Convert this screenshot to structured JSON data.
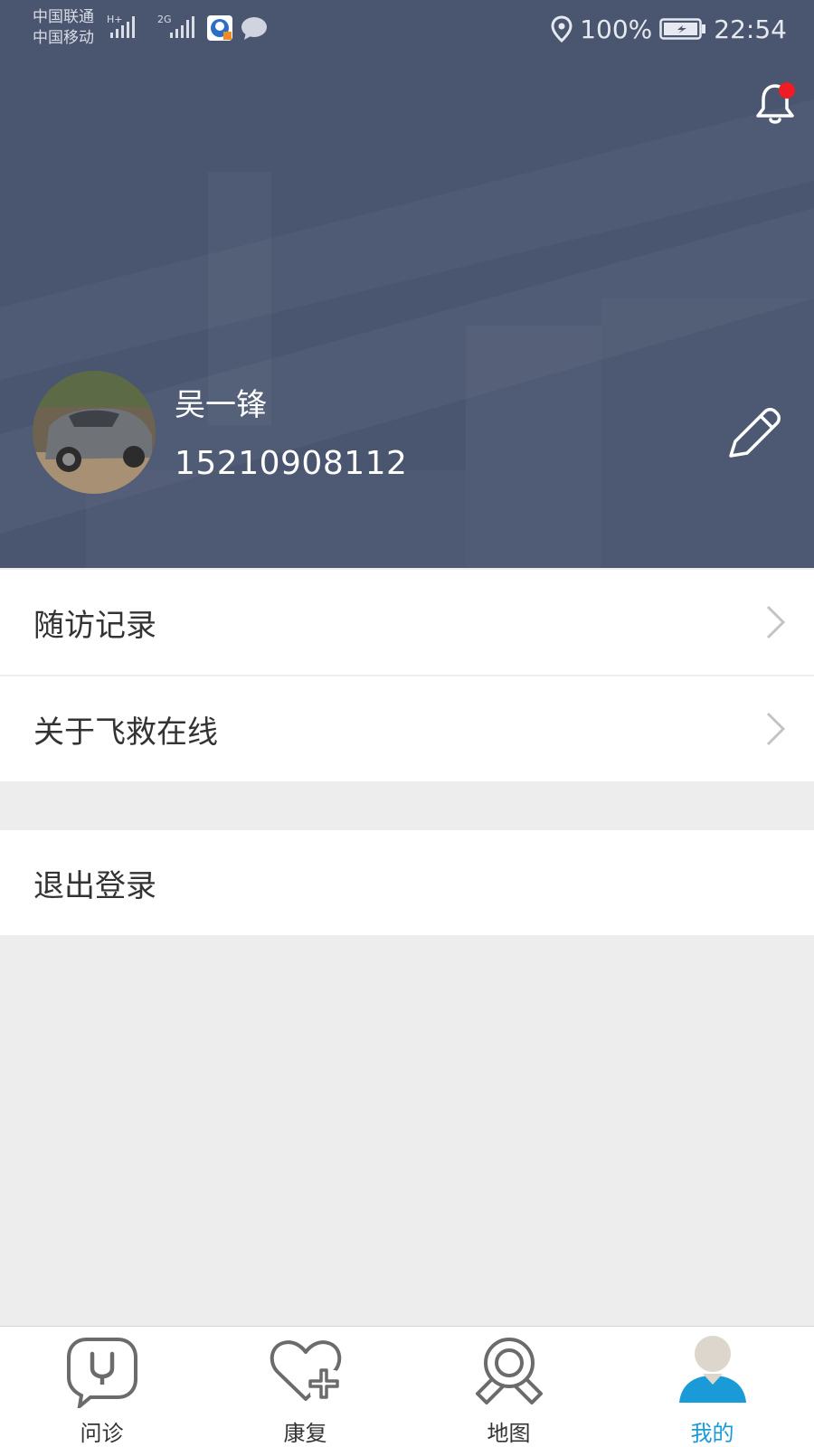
{
  "status_bar": {
    "carrier_1": "中国联通",
    "carrier_2": "中国移动",
    "network_1": "H+",
    "network_2": "2G",
    "battery": "100%",
    "time": "22:54"
  },
  "header": {
    "bg_color": "#4a5670",
    "has_notification": true
  },
  "profile": {
    "name": "吴一锋",
    "phone": "15210908112"
  },
  "menu": {
    "items": [
      {
        "label": "随访记录"
      },
      {
        "label": "关于飞救在线"
      }
    ],
    "logout_label": "退出登录"
  },
  "tabbar": {
    "active_color": "#1a9bd7",
    "tabs": [
      {
        "label": "问诊",
        "icon": "stethoscope-icon"
      },
      {
        "label": "康复",
        "icon": "heart-plus-icon"
      },
      {
        "label": "地图",
        "icon": "map-pin-icon"
      },
      {
        "label": "我的",
        "icon": "user-icon",
        "active": true
      }
    ]
  }
}
